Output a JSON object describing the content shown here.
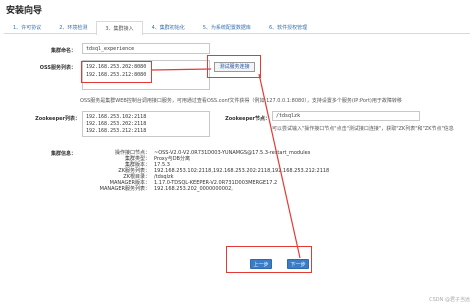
{
  "page": {
    "title": "安装向导"
  },
  "tabs": [
    {
      "label": "1、许可协议",
      "active": false
    },
    {
      "label": "2、环境检测",
      "active": false
    },
    {
      "label": "3、集群接入",
      "active": true
    },
    {
      "label": "4、集群初始化",
      "active": false
    },
    {
      "label": "5、为系统配置数据库",
      "active": false
    },
    {
      "label": "6、软件授权管理",
      "active": false
    }
  ],
  "form": {
    "cluster_name_label": "集群命名：",
    "cluster_name_value": "tdsql_experience",
    "oss_label": "OSS服务列表：",
    "oss_line1": "192.168.253.202:8080",
    "oss_line2": "192.168.253.212:8080",
    "test_button_label": "测试服务连接",
    "oss_hint": "OSS服务是集群WEB控制台调用接口服务，可用通过查看OSS.conf文件获得（例如:127.0.0.1:8080），支持设置多个服务(IP:Port)用于故障转移",
    "zk_label": "Zookeeper列表：",
    "zk_line1": "192.168.253.102:2118",
    "zk_line2": "192.168.253.202:2118",
    "zk_line3": "192.168.253.212:2118",
    "zk_node_label": "Zookeeper节点：",
    "zk_node_value": "/tdsqlzk",
    "zk_node_hint": "可以尝试输入\"操作接口节点\"点击\"测试接口连接\"，获取\"ZK列表\"和\"ZK节点\"信息",
    "cluster_info_label": "集群信息："
  },
  "cluster_info": [
    {
      "key": "操作接口节点：",
      "value": "~OSS-V2.0-V2.0R731D003-YUNAMGS@17.5.3-restart_modules"
    },
    {
      "key": "集群类型：",
      "value": "Proxy与DB分离"
    },
    {
      "key": "集群版本：",
      "value": "17.5.3"
    },
    {
      "key": "ZK服务列表：",
      "value": "192.168.253.102:2118,192.168.253.202:2118,192.168.253.212:2118"
    },
    {
      "key": "ZK根目录：",
      "value": "/tdsqlzk"
    },
    {
      "key": "MANAGER版本：",
      "value": "1.17.0-TDSQL-KEEPER-V2.0R731D003MERGE17.2"
    },
    {
      "key": "MANAGER服务列表：",
      "value": "192.168.253.202_0000000002,"
    }
  ],
  "nav": {
    "prev_label": "上一步",
    "next_label": "下一步"
  },
  "watermark": "CSDN @君子当远",
  "colors": {
    "accent": "#3b7cc7",
    "highlight": "#e53935",
    "link": "#3572b0"
  }
}
